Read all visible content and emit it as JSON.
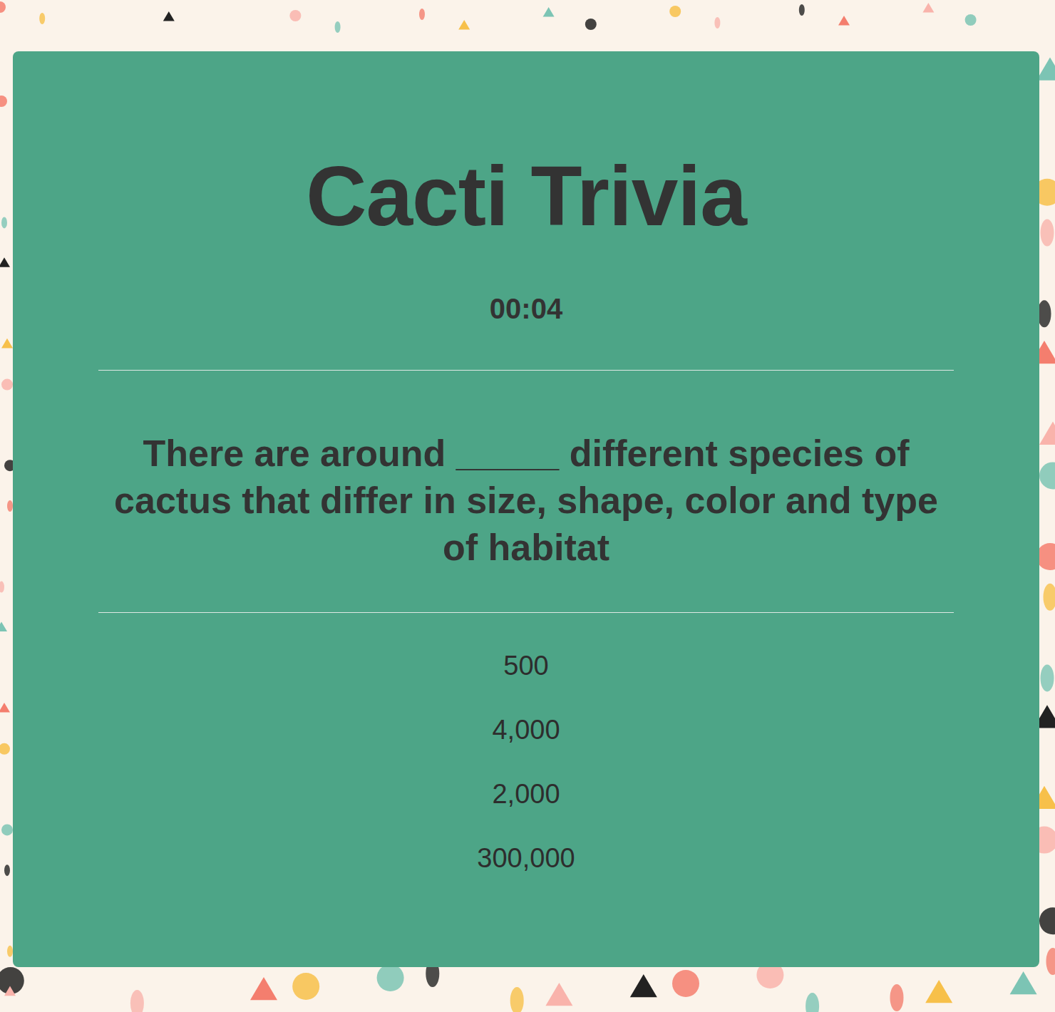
{
  "title": "Cacti Trivia",
  "timer": "00:04",
  "question": "There are around _____ different species of cactus that differ in size, shape, color and type of habitat",
  "answers": [
    "500",
    "4,000",
    "2,000",
    "300,000"
  ]
}
